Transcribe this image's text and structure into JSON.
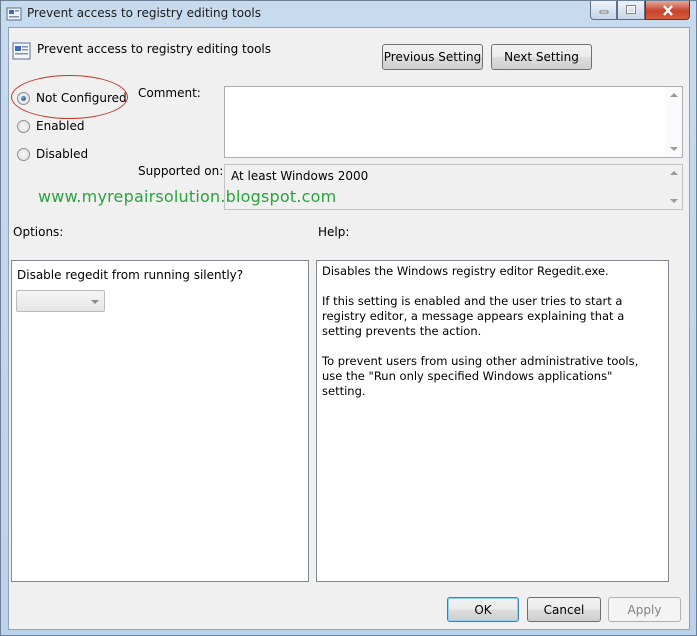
{
  "window": {
    "title": "Prevent access to registry editing tools",
    "accent_close": "#c7432c"
  },
  "header": {
    "policy_name": "Prevent access to registry editing tools",
    "previous_label": "Previous Setting",
    "next_label": "Next Setting"
  },
  "state": {
    "options": [
      {
        "label": "Not Configured",
        "checked": true
      },
      {
        "label": "Enabled",
        "checked": false
      },
      {
        "label": "Disabled",
        "checked": false
      }
    ]
  },
  "comment": {
    "label": "Comment:",
    "value": ""
  },
  "supported": {
    "label": "Supported on:",
    "value": "At least Windows 2000"
  },
  "watermark": "www.myrepairsolution.blogspot.com",
  "options_pane": {
    "label": "Options:",
    "question": "Disable regedit from running silently?",
    "dropdown_value": ""
  },
  "help_pane": {
    "label": "Help:",
    "paragraphs": [
      "Disables the Windows registry editor Regedit.exe.",
      "If this setting is enabled and the user tries to start a registry editor, a message appears explaining that a setting prevents the action.",
      "To prevent users from using other administrative tools, use the \"Run only specified Windows applications\" setting."
    ]
  },
  "footer": {
    "ok_label": "OK",
    "cancel_label": "Cancel",
    "apply_label": "Apply"
  }
}
